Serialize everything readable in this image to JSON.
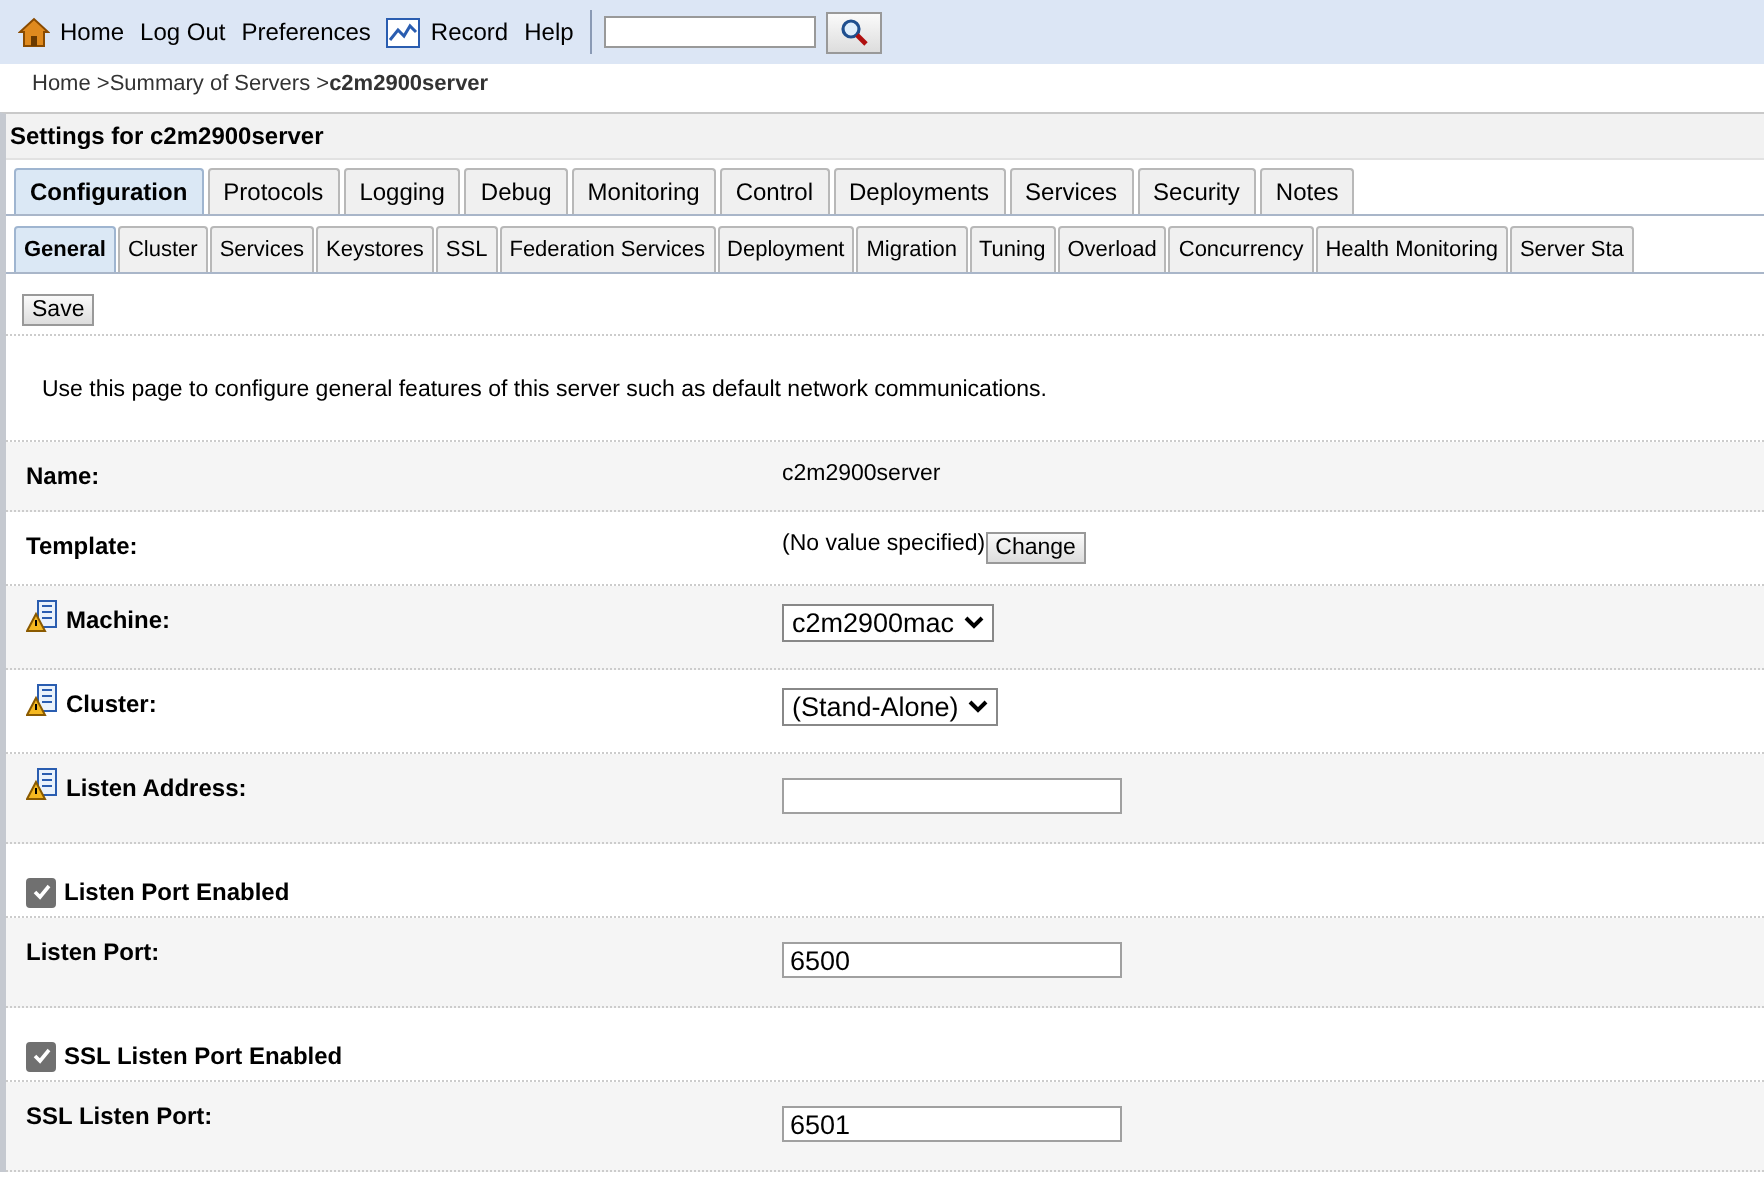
{
  "toolbar": {
    "links": [
      {
        "label": "Home",
        "kind": "home"
      },
      {
        "label": "Log Out",
        "kind": "plain"
      },
      {
        "label": "Preferences",
        "kind": "plain"
      },
      {
        "label": "Record",
        "kind": "chart"
      },
      {
        "label": "Help",
        "kind": "plain"
      }
    ]
  },
  "breadcrumb": {
    "items": [
      "Home >",
      "Summary of Servers >"
    ],
    "current": "c2m2900server"
  },
  "settings_title": "Settings for c2m2900server",
  "tabs": [
    {
      "label": "Configuration",
      "selected": true
    },
    {
      "label": "Protocols",
      "selected": false
    },
    {
      "label": "Logging",
      "selected": false
    },
    {
      "label": "Debug",
      "selected": false
    },
    {
      "label": "Monitoring",
      "selected": false
    },
    {
      "label": "Control",
      "selected": false
    },
    {
      "label": "Deployments",
      "selected": false
    },
    {
      "label": "Services",
      "selected": false
    },
    {
      "label": "Security",
      "selected": false
    },
    {
      "label": "Notes",
      "selected": false
    }
  ],
  "subtabs": [
    {
      "label": "General",
      "selected": true
    },
    {
      "label": "Cluster",
      "selected": false
    },
    {
      "label": "Services",
      "selected": false
    },
    {
      "label": "Keystores",
      "selected": false
    },
    {
      "label": "SSL",
      "selected": false
    },
    {
      "label": "Federation Services",
      "selected": false
    },
    {
      "label": "Deployment",
      "selected": false
    },
    {
      "label": "Migration",
      "selected": false
    },
    {
      "label": "Tuning",
      "selected": false
    },
    {
      "label": "Overload",
      "selected": false
    },
    {
      "label": "Concurrency",
      "selected": false
    },
    {
      "label": "Health Monitoring",
      "selected": false
    },
    {
      "label": "Server Sta",
      "selected": false
    }
  ],
  "save_button": "Save",
  "description": "Use this page to configure general features of this server such as default network communications.",
  "fields": [
    {
      "kind": "text",
      "label": "Name:",
      "warning": false,
      "value": "c2m2900server"
    },
    {
      "kind": "button",
      "label": "Template:",
      "warning": false,
      "value": "(No value specified)",
      "button": "Change"
    },
    {
      "kind": "select",
      "label": "Machine:",
      "warning": true,
      "value": "c2m2900mac"
    },
    {
      "kind": "select",
      "label": "Cluster:",
      "warning": true,
      "value": "(Stand-Alone)"
    },
    {
      "kind": "input",
      "label": "Listen Address:",
      "warning": true
    },
    {
      "kind": "checkbox",
      "label": "Listen Port Enabled",
      "checked": true
    },
    {
      "kind": "input",
      "label": "Listen Port:",
      "warning": false,
      "value": "6500"
    },
    {
      "kind": "checkbox",
      "label": "SSL Listen Port Enabled",
      "checked": true
    },
    {
      "kind": "input",
      "label": "SSL Listen Port:",
      "warning": false,
      "value": "6501"
    }
  ]
}
